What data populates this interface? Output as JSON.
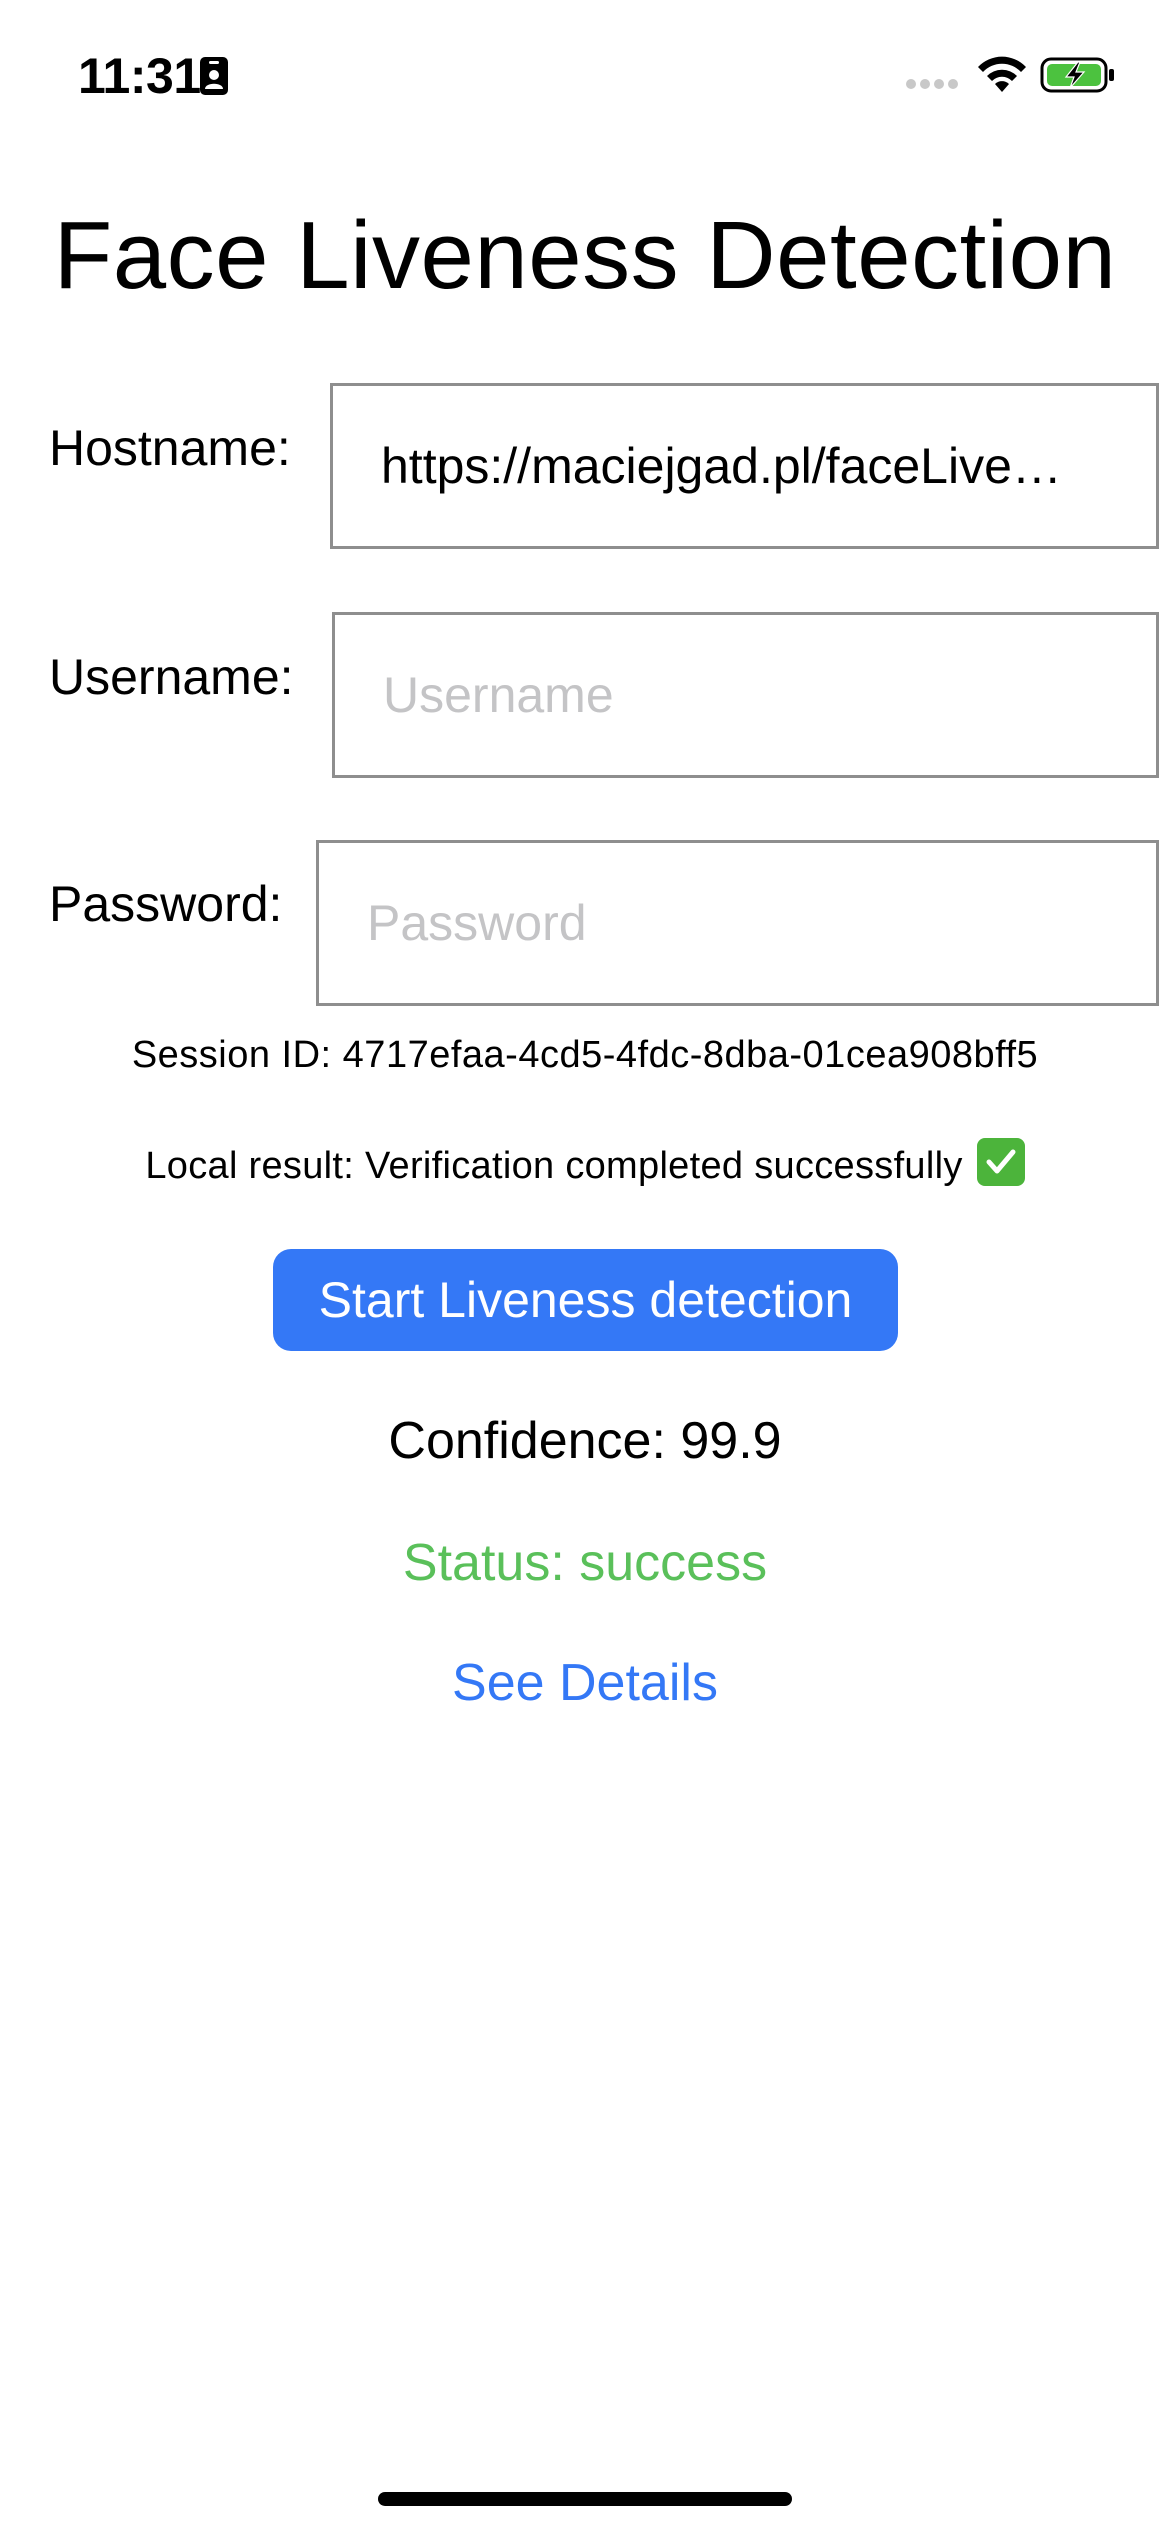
{
  "status_bar": {
    "time": "11:31",
    "icons": [
      "id-card-icon",
      "cellular-signal-icon",
      "wifi-icon",
      "battery-charging-icon"
    ]
  },
  "title": "Face Liveness Detection",
  "form": {
    "hostname": {
      "label": "Hostname:",
      "value": "https://maciejgad.pl/faceLive…",
      "placeholder": ""
    },
    "username": {
      "label": "Username:",
      "value": "",
      "placeholder": "Username"
    },
    "password": {
      "label": "Password:",
      "value": "",
      "placeholder": "Password"
    }
  },
  "session_id_text": "Session ID: 4717efaa-4cd5-4fdc-8dba-01cea908bff5",
  "local_result_text": "Local result: Verification completed successfully",
  "start_button_label": "Start Liveness detection",
  "confidence_text": "Confidence: 99.9",
  "status_text": "Status: success",
  "see_details_label": "See Details",
  "colors": {
    "accent_blue": "#3478f6",
    "success_green": "#5ac05a",
    "battery_green": "#4cc23f",
    "field_border": "#8e8e8e",
    "placeholder_gray": "#c4c4c6"
  }
}
